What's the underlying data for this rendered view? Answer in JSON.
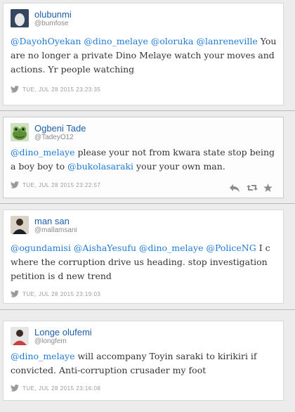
{
  "colors": {
    "link": "#1f7ad4",
    "name": "#1f5fa8",
    "meta": "#9a9a9a"
  },
  "tweets": [
    {
      "name": "olubunmi",
      "handle": "@bumfose",
      "text_parts": [
        {
          "t": "@DayohOyekan",
          "m": true
        },
        {
          "t": " ",
          "m": false
        },
        {
          "t": "@dino_melaye",
          "m": true
        },
        {
          "t": " ",
          "m": false
        },
        {
          "t": "@oloruka",
          "m": true
        },
        {
          "t": " ",
          "m": false
        },
        {
          "t": "@lanreneville",
          "m": true
        },
        {
          "t": " You are no longer a private Dino Melaye watch your moves and actions. Yr people watching",
          "m": false
        }
      ],
      "timestamp": "TUE, JUL 28 2015 23:23:35",
      "avatar_icon": "default-egg-avatar"
    },
    {
      "name": "Ogbeni Tade",
      "handle": "@TadeyO12",
      "text_parts": [
        {
          "t": "@dino_melaye",
          "m": true
        },
        {
          "t": " please your not from kwara state stop being a boy boy to ",
          "m": false
        },
        {
          "t": "@bukolasaraki",
          "m": true
        },
        {
          "t": " your your own man.",
          "m": false
        }
      ],
      "timestamp": "TUE, JUL 28 2015 23:22:57",
      "avatar_icon": "frog-avatar",
      "actions": [
        "reply-icon",
        "retweet-icon",
        "favorite-icon"
      ]
    },
    {
      "name": "man san",
      "handle": "@mallamsani",
      "text_parts": [
        {
          "t": "@ogundamisi",
          "m": true
        },
        {
          "t": " ",
          "m": false
        },
        {
          "t": "@AishaYesufu",
          "m": true
        },
        {
          "t": " ",
          "m": false
        },
        {
          "t": "@dino_melaye",
          "m": true
        },
        {
          "t": " ",
          "m": false
        },
        {
          "t": "@PoliceNG",
          "m": true
        },
        {
          "t": " I c where the corruption drive us heading. stop investigation petition is d new trend",
          "m": false
        }
      ],
      "timestamp": "TUE, JUL 28 2015 23:19:03",
      "avatar_icon": "photo-avatar"
    },
    {
      "name": "Longe olufemi",
      "handle": "@longfem",
      "text_parts": [
        {
          "t": "@dino_melaye",
          "m": true
        },
        {
          "t": " will accompany Toyin saraki to kirikiri if convicted. Anti-corruption crusader my foot",
          "m": false
        }
      ],
      "timestamp": "TUE, JUL 28 2015 23:16:08",
      "avatar_icon": "person-avatar"
    }
  ]
}
